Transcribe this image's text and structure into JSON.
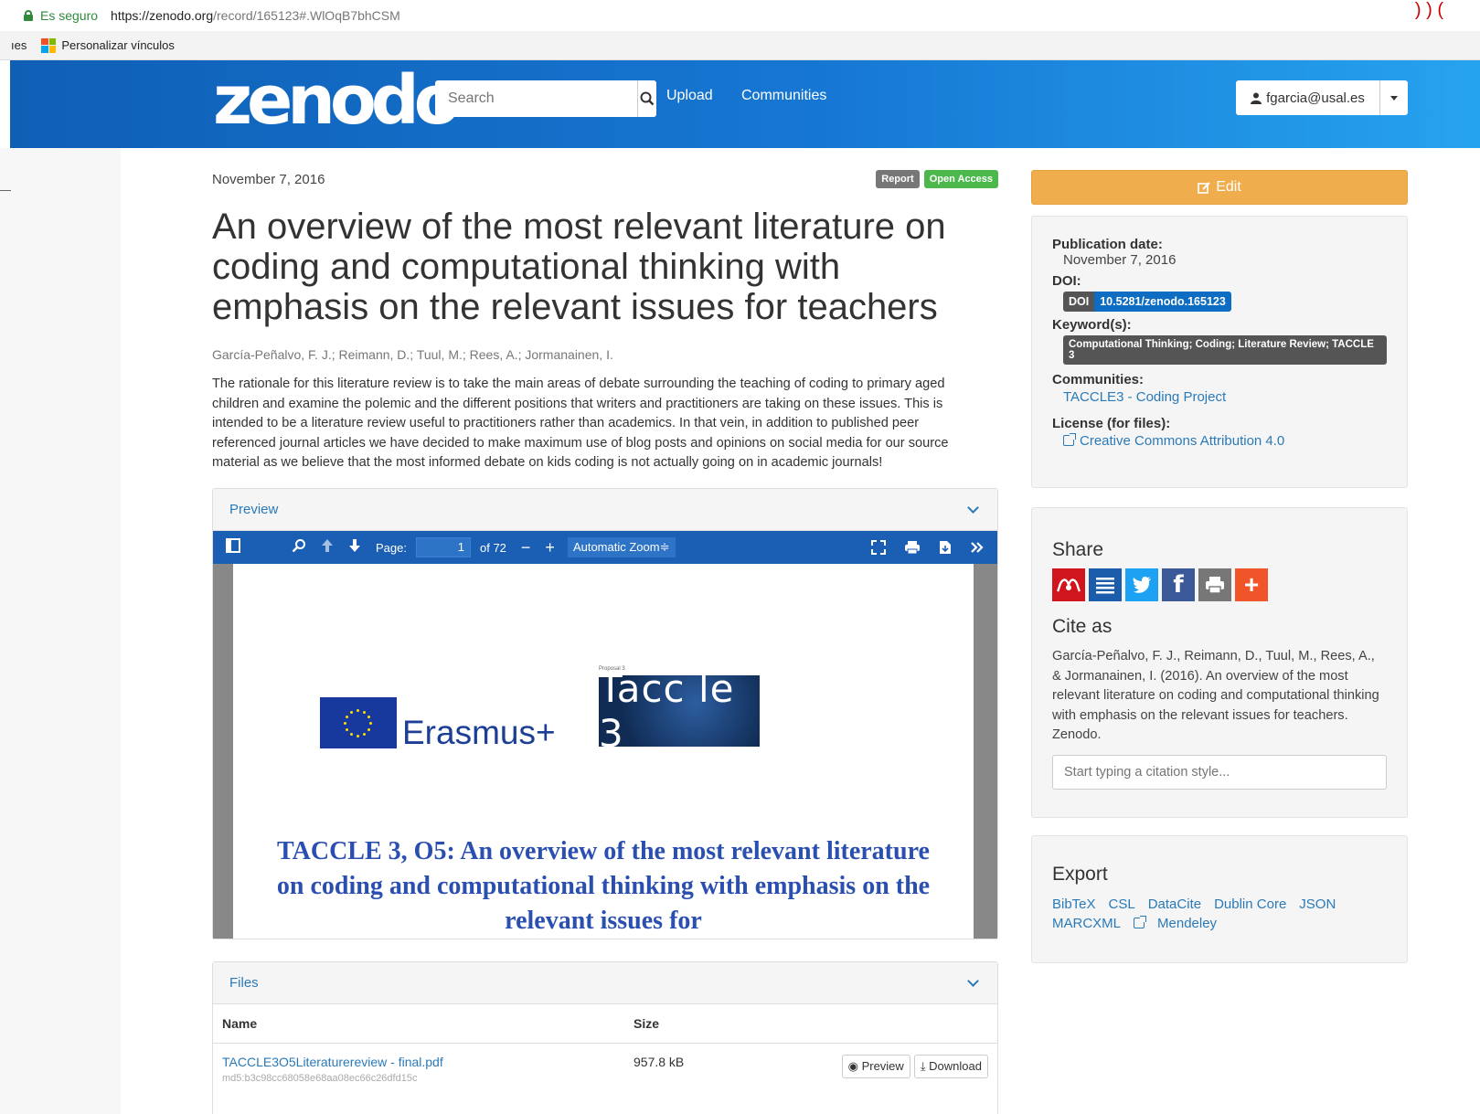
{
  "browser": {
    "secure_label": "Es seguro",
    "url_scheme_host": "https://zenodo.org",
    "url_path": "/record/165123#.WlOqB7bhCSM",
    "bookmarks_left": "ıes",
    "bookmark_item": "Personalizar vínculos"
  },
  "navbar": {
    "logo": "zenodo",
    "search_placeholder": "Search",
    "upload": "Upload",
    "communities": "Communities",
    "user": "fgarcia@usal.es"
  },
  "record": {
    "date": "November 7, 2016",
    "badges": [
      "Report",
      "Open Access"
    ],
    "title": "An overview of the most relevant literature on coding and computational thinking with emphasis on the relevant issues for teachers",
    "authors": "García-Peñalvo, F. J.; Reimann, D.; Tuul, M.; Rees, A.; Jormanainen, I.",
    "abstract": "The rationale for this literature review is to take the main areas of debate surrounding the teaching of coding to primary aged children and examine the polemic and the different positions that writers and practitioners are taking on these issues. This is intended to be a literature review useful to practitioners rather than academics. In that vein, in addition to published peer referenced journal articles we have decided to make maximum use of blog posts and opinions on social media for our source material as we believe that the most informed debate on kids coding is not actually going on in academic journals!"
  },
  "preview": {
    "heading": "Preview",
    "toolbar": {
      "page_label": "Page:",
      "page_value": "1",
      "page_total": "of 72",
      "zoom": "Automatic Zoom",
      "zoom_arrow": "≑"
    },
    "pdf": {
      "erasmus": "Erasmus+",
      "proposal": "Proposal 3",
      "tacc_logo": "Tacc le 3",
      "heading": "TACCLE 3, O5: An overview of the most relevant literature on coding and computational thinking with emphasis on the relevant issues for"
    }
  },
  "files": {
    "heading": "Files",
    "columns": [
      "Name",
      "Size"
    ],
    "rows": [
      {
        "name": "TACCLE3O5Literaturereview - final.pdf",
        "md5": "md5:b3c98cc68058e68aa08ec66c26dfd15c",
        "size": "957.8 kB",
        "preview": "Preview",
        "download": "Download"
      }
    ]
  },
  "sidebar": {
    "edit": "Edit",
    "publication_date_label": "Publication date:",
    "publication_date": "November 7, 2016",
    "doi_label": "DOI:",
    "doi_prefix": "DOI",
    "doi": "10.5281/zenodo.165123",
    "keywords_label": "Keyword(s):",
    "keywords": "Computational Thinking; Coding; Literature Review; TACCLE 3",
    "communities_label": "Communities:",
    "community": "TACCLE3 - Coding Project",
    "license_label": "License (for files):",
    "license": "Creative Commons Attribution 4.0",
    "share_heading": "Share",
    "cite_heading": "Cite as",
    "citation": "García-Peñalvo, F. J., Reimann, D., Tuul, M., Rees, A., & Jormanainen, I. (2016). An overview of the most relevant literature on coding and computational thinking with emphasis on the relevant issues for teachers. Zenodo.",
    "cite_placeholder": "Start typing a citation style...",
    "export_heading": "Export",
    "export_links": [
      "BibTeX",
      "CSL",
      "DataCite",
      "Dublin Core",
      "JSON",
      "MARCXML"
    ],
    "mendeley": "Mendeley"
  },
  "colors": {
    "navbar_start": "#0f5fb5",
    "navbar_end": "#26a3ef",
    "edit": "#f0ad4e",
    "open_access": "#4cb84c",
    "doi": "#0d6dc3",
    "link": "#2a7ab8"
  }
}
